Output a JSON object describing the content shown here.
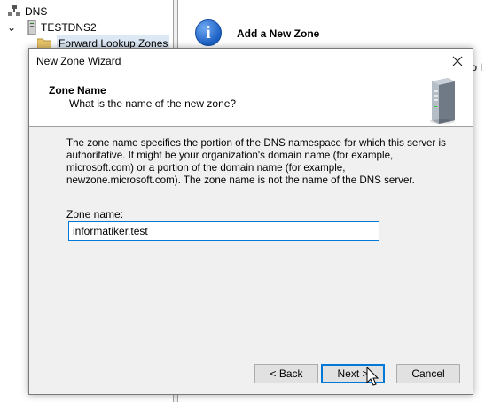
{
  "tree": {
    "root": "DNS",
    "server": "TESTDNS2",
    "folder": "Forward Lookup Zones"
  },
  "right_pane": {
    "title": "Add a New Zone",
    "cut_text": "to l"
  },
  "dialog": {
    "title": "New Zone Wizard",
    "header_title": "Zone Name",
    "header_subtitle": "What is the name of the new zone?",
    "description": "The zone name specifies the portion of the DNS namespace for which this server is authoritative. It might be your organization's domain name (for example, microsoft.com) or a portion of the domain name (for example, newzone.microsoft.com). The zone name is not the name of the DNS server.",
    "zone_label": "Zone name:",
    "zone_value": "informatiker.test",
    "buttons": {
      "back": "< Back",
      "next": "Next >",
      "cancel": "Cancel"
    }
  },
  "colors": {
    "accent": "#0078d7",
    "dialog_bg": "#f0f0f0"
  },
  "icons": [
    "dns-icon",
    "server-icon",
    "folder-icon",
    "info-icon",
    "close-icon",
    "server-tower-icon",
    "mouse-cursor-icon"
  ]
}
